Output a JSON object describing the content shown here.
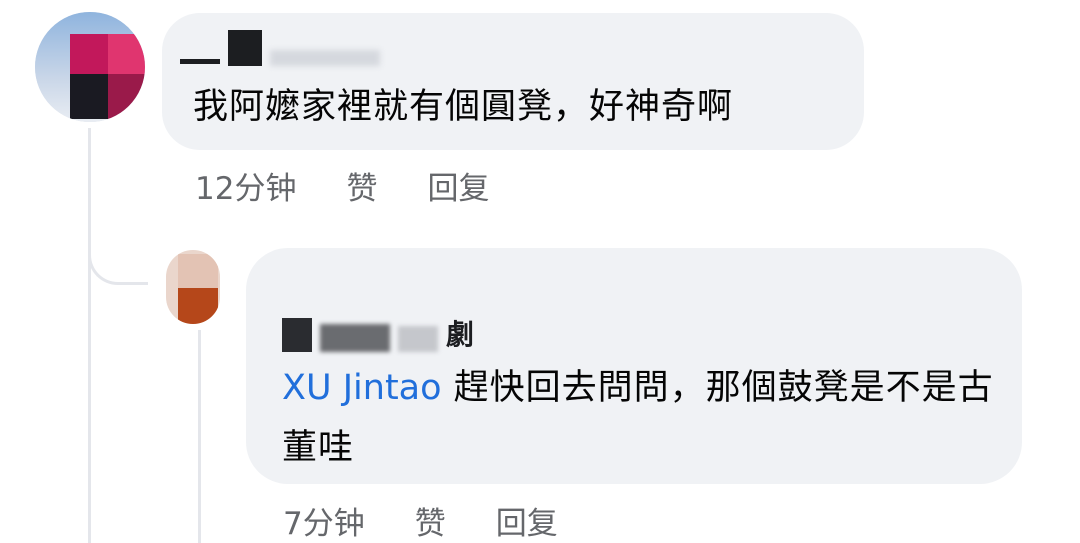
{
  "thread": {
    "comments": [
      {
        "text": "我阿嬤家裡就有個圓凳，好神奇啊",
        "time": "12分钟",
        "like_label": "赞",
        "reply_label": "回复"
      },
      {
        "author_visible_fragment": "劇",
        "mention": "XU Jintao",
        "text": " 趕快回去問問，那個鼓凳是不是古董哇",
        "time": "7分钟",
        "like_label": "赞",
        "reply_label": "回复"
      }
    ]
  },
  "colors": {
    "bubble_bg": "#f0f2f5",
    "meta_text": "#65676b",
    "mention": "#216fdb",
    "body_text": "#050505"
  }
}
